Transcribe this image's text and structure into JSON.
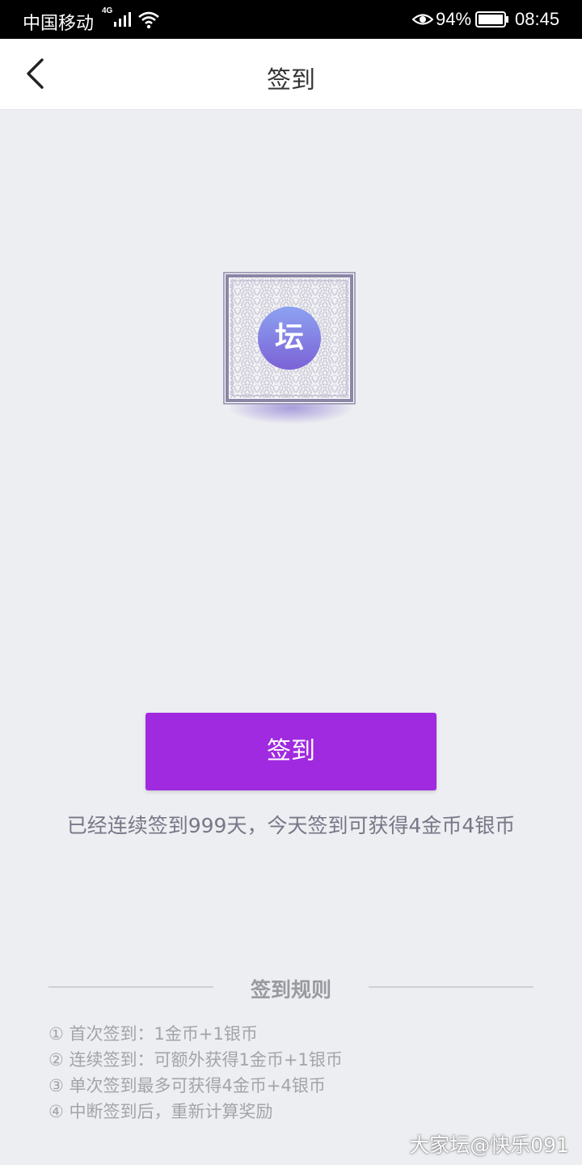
{
  "status_bar": {
    "carrier": "中国移动",
    "network_type": "4G",
    "battery_percent": "94%",
    "time": "08:45",
    "icons": [
      "signal-icon",
      "wifi-icon",
      "eye-icon",
      "battery-icon"
    ]
  },
  "header": {
    "back_icon": "chevron-left-icon",
    "title": "签到"
  },
  "badge": {
    "character": "坛"
  },
  "signin_button": {
    "label": "签到",
    "color": "#a02ae0"
  },
  "streak_info": "已经连续签到999天，今天签到可获得4金币4银币",
  "rules": {
    "title": "签到规则",
    "items": [
      "① 首次签到：1金币+1银币",
      "② 连续签到：可额外获得1金币+1银币",
      "③ 单次签到最多可获得4金币+4银币",
      "④ 中断签到后，重新计算奖励"
    ]
  },
  "watermark": "大家坛@快乐091"
}
